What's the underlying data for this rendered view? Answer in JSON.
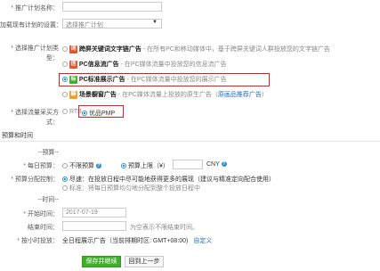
{
  "form": {
    "plan_name_label": "推广计划名称：",
    "copy_label": "加载现有计划的设置：",
    "copy_placeholder": "选择推广计划",
    "type_label_1": "选择推广计划类",
    "type_label_2": "型：",
    "types": [
      {
        "icon_text": "词",
        "icon_color": "#e8542c",
        "title": "跨屏关键词文字链广告",
        "desc": "- 在所有PC和移动媒体中，基于跨屏关键词人群投放您的文字链广告",
        "extra": ""
      },
      {
        "icon_text": "信",
        "icon_color": "#e8542c",
        "title": "PC信息流广告",
        "desc": "- 在PC媒体流量中投放您的信息流广告",
        "extra": ""
      },
      {
        "icon_text": "标",
        "icon_color": "#3fae29",
        "title": "PC标准展示广告",
        "desc": "- 在PC媒体流量中投放您的展示广告",
        "extra": ""
      },
      {
        "icon_text": "橱",
        "icon_color": "#f0a020",
        "title": "场景橱窗广告",
        "desc": "- 在PC媒体流量上投放的原生广告（",
        "extra": "原画品推荐广告",
        "extra_tail": "）"
      }
    ],
    "buy_label_1": "选择流量采买方",
    "buy_label_2": "式：",
    "buy_options": [
      "RTB",
      "优品PMP"
    ]
  },
  "budget": {
    "section_title": "预算和时间",
    "budget_group": "--预算--",
    "daily_label": "每日预算：",
    "daily_options": [
      "不限预算",
      "预算上限（¥）"
    ],
    "currency": "CNY",
    "dist_label": "预算分配控制：",
    "dist_options": [
      "尽速：在投放日程中尽可能地获得更多的展现（建议与精准定向配合使用）",
      "标准：将每日预算均匀地分配到整个投放日程中"
    ],
    "time_group": "--时间--",
    "start_label": "开始时间：",
    "start_value": "2017-07-19",
    "end_label": "结束时间：",
    "end_hint": "为空表示不限结束时间。",
    "hour_label": "按小时投放：",
    "hour_value": "全日程展示广告（当前排期时区: GMT+08:00)",
    "custom_link": "自定义"
  },
  "actions": {
    "save": "保存并继续",
    "back": "回到上一步"
  }
}
